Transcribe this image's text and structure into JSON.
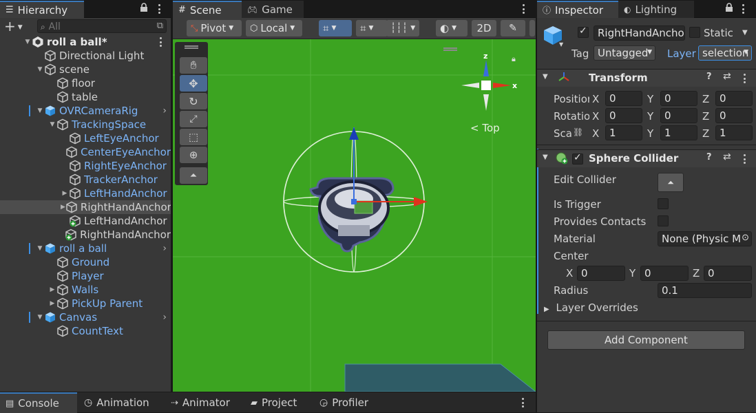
{
  "hierarchy": {
    "tab_label": "Hierarchy",
    "add_label": "+",
    "search_placeholder": "All",
    "items": [
      {
        "label": "roll a ball*"
      },
      {
        "label": "Directional Light"
      },
      {
        "label": "scene"
      },
      {
        "label": "floor"
      },
      {
        "label": "table"
      },
      {
        "label": "OVRCameraRig"
      },
      {
        "label": "TrackingSpace"
      },
      {
        "label": "LeftEyeAnchor"
      },
      {
        "label": "CenterEyeAnchor"
      },
      {
        "label": "RightEyeAnchor"
      },
      {
        "label": "TrackerAnchor"
      },
      {
        "label": "LeftHandAnchor"
      },
      {
        "label": "RightHandAnchor"
      },
      {
        "label": "LeftHandAnchor"
      },
      {
        "label": "RightHandAnchor"
      },
      {
        "label": "roll a ball"
      },
      {
        "label": "Ground"
      },
      {
        "label": "Player"
      },
      {
        "label": "Walls"
      },
      {
        "label": "PickUp Parent"
      },
      {
        "label": "Canvas"
      },
      {
        "label": "CountText"
      }
    ]
  },
  "scene": {
    "tabs": [
      {
        "label": "Scene"
      },
      {
        "label": "Game"
      }
    ],
    "toolbar": {
      "pivot": "Pivot",
      "local": "Local",
      "twod": "2D"
    },
    "gizmo_label": "Top",
    "gizmo_axes": {
      "z": "z",
      "x": "x"
    }
  },
  "inspector": {
    "tabs": [
      {
        "label": "Inspector"
      },
      {
        "label": "Lighting"
      }
    ],
    "object_name": "RightHandAncho",
    "static_label": "Static",
    "tag_label": "Tag",
    "tag_value": "Untagged",
    "layer_label": "Layer",
    "layer_value": "selection",
    "transform": {
      "title": "Transform",
      "position_label": "Position",
      "rotation_label": "Rotation",
      "scale_label": "Scale",
      "position": {
        "x": "0",
        "y": "0",
        "z": "0"
      },
      "rotation": {
        "x": "0",
        "y": "0",
        "z": "0"
      },
      "scale": {
        "x": "1",
        "y": "1",
        "z": "1"
      }
    },
    "collider": {
      "title": "Sphere Collider",
      "edit_collider": "Edit Collider",
      "is_trigger": "Is Trigger",
      "provides_contacts": "Provides Contacts",
      "material_label": "Material",
      "material_value": "None (Physic M",
      "center_label": "Center",
      "center": {
        "x": "0",
        "y": "0",
        "z": "0"
      },
      "radius_label": "Radius",
      "radius_value": "0.1",
      "layer_overrides": "Layer Overrides"
    },
    "add_component": "Add Component"
  },
  "bottom_tabs": [
    {
      "label": "Console"
    },
    {
      "label": "Animation"
    },
    {
      "label": "Animator"
    },
    {
      "label": "Project"
    },
    {
      "label": "Profiler"
    }
  ],
  "axis_letters": {
    "x": "X",
    "y": "Y",
    "z": "Z"
  },
  "colors": {
    "accent": "#3a79bb",
    "viewport": "#3ca421",
    "prefab_blue": "#7cb4f7",
    "selection": "#4b6a93"
  }
}
